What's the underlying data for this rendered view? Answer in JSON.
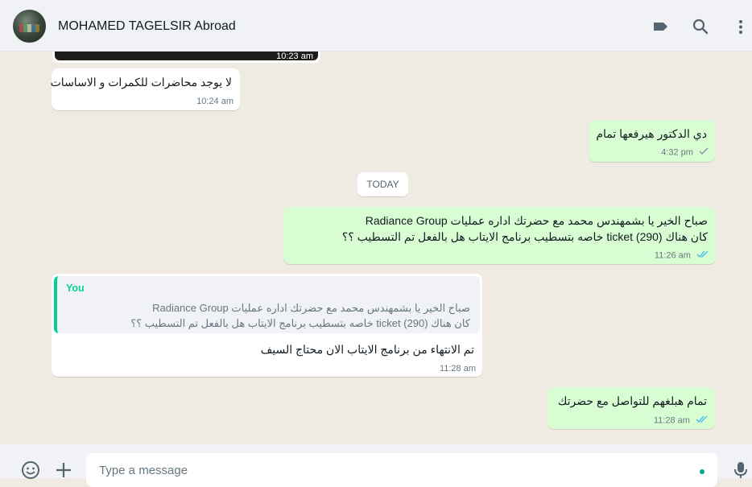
{
  "header": {
    "contact_name": "MOHAMED TAGELSIR Abroad",
    "icons": [
      "label-icon",
      "search-icon",
      "menu-icon"
    ]
  },
  "messages": {
    "image_time": "10:23 am",
    "m1": {
      "text": "لا يوجد محاضرات للكمرات و الاساسات",
      "time": "10:24 am"
    },
    "m2": {
      "text": "دي الدكتور هيرفعها تمام",
      "time": "4:32 pm"
    },
    "today": "TODAY",
    "m3": {
      "line1": "صباح الخير يا بشمهندس محمد مع حضرتك اداره عمليات Radiance Group",
      "line2": "كان هناك (290) ticket خاصه بتسطيب برنامج الايتاب هل بالفعل تم التسطيب ؟؟",
      "time": "11:26 am"
    },
    "m4": {
      "quote_author": "You",
      "quote_line1": "صباح الخير يا بشمهندس محمد مع حضرتك اداره عمليات Radiance Group",
      "quote_line2": "كان هناك (290) ticket خاصه بتسطيب برنامج الايتاب هل بالفعل تم التسطيب ؟؟",
      "text": "تم الانتهاء من برنامج الايتاب الان محتاج السيف",
      "time": "11:28 am"
    },
    "m5": {
      "text": "تمام هبلغهم للتواصل مع حضرتك",
      "time": "11:28 am"
    }
  },
  "composer": {
    "placeholder": "Type a message"
  },
  "colors": {
    "outgoing_bg": "#d9fdd3",
    "incoming_bg": "#ffffff",
    "read_tick": "#53bdeb",
    "accent": "#00a884"
  }
}
